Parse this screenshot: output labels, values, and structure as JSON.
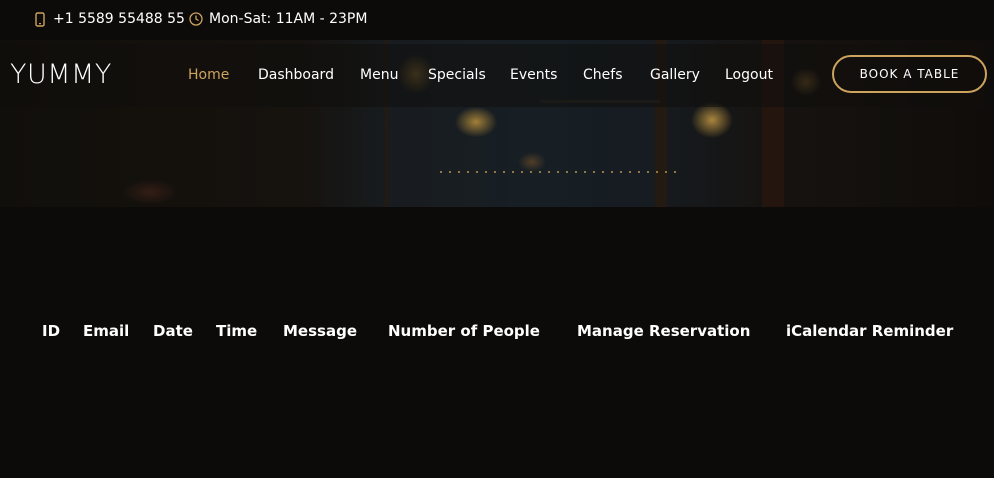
{
  "topbar": {
    "phone": "+1 5589 55488 55",
    "phone_icon": "phone-icon",
    "hours": "Mon-Sat: 11AM - 23PM",
    "hours_icon": "clock-icon"
  },
  "brand": {
    "name": "YUMMY"
  },
  "nav": {
    "items": [
      "Home",
      "Dashboard",
      "Menu",
      "Specials",
      "Events",
      "Chefs",
      "Gallery",
      "Logout"
    ],
    "active": "Home"
  },
  "cta": {
    "label": "BOOK A TABLE"
  },
  "table": {
    "headers": [
      "ID",
      "Email",
      "Date",
      "Time",
      "Message",
      "Number of People",
      "Manage Reservation",
      "iCalendar Reminder"
    ]
  },
  "colors": {
    "background": "#0c0b09",
    "accent": "#cda45e",
    "text": "#ffffff"
  }
}
